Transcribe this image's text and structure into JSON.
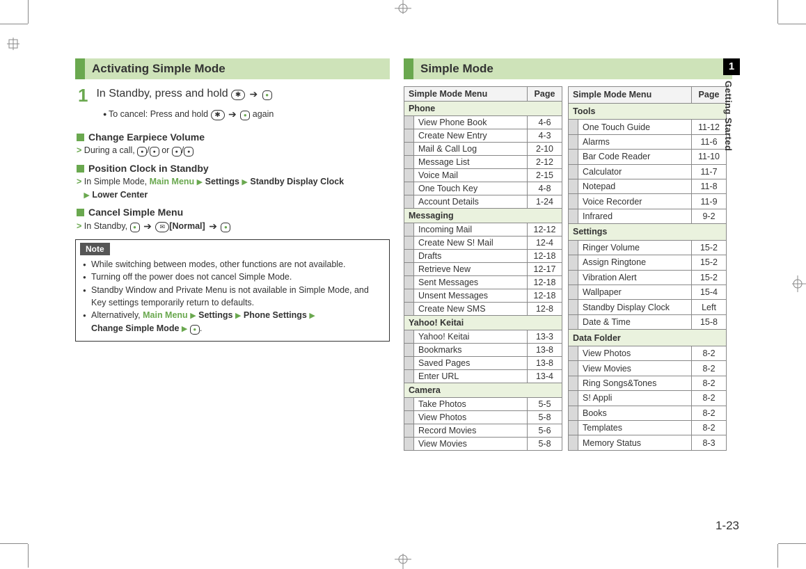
{
  "chapter_number": "1",
  "chapter_title": "Getting Started",
  "page_number": "1-23",
  "left": {
    "heading": "Activating Simple Mode",
    "step1_num": "1",
    "step1_text_a": "In Standby, press and hold ",
    "step1_cancel": "To cancel: Press and hold ",
    "step1_cancel_tail": " again",
    "sub1_head": "Change Earpiece Volume",
    "sub1_body_a": "During a call, ",
    "sub1_body_b": " or ",
    "sub2_head": "Position Clock in Standby",
    "sub2_body_a": "In Simple Mode, ",
    "sub2_mainmenu": "Main Menu",
    "sub2_settings": "Settings",
    "sub2_sdc": "Standby Display Clock",
    "sub2_lc": "Lower Center",
    "sub3_head": "Cancel Simple Menu",
    "sub3_body_a": "In Standby, ",
    "sub3_normal": "[Normal]",
    "note_label": "Note",
    "notes": [
      "While switching between modes, other functions are not available.",
      "Turning off the power does not cancel Simple Mode.",
      "Standby Window and Private Menu is not available in Simple Mode, and Key settings temporarily return to defaults."
    ],
    "note4_a": "Alternatively, ",
    "note4_mainmenu": "Main Menu",
    "note4_settings": "Settings",
    "note4_phone": "Phone Settings",
    "note4_csm": "Change Simple Mode"
  },
  "right": {
    "heading": "Simple Mode",
    "col_menu": "Simple Mode Menu",
    "col_page": "Page",
    "tableA": [
      {
        "cat": "Phone"
      },
      {
        "name": "View Phone Book",
        "page": "4-6"
      },
      {
        "name": "Create New Entry",
        "page": "4-3"
      },
      {
        "name": "Mail & Call Log",
        "page": "2-10"
      },
      {
        "name": "Message List",
        "page": "2-12"
      },
      {
        "name": "Voice Mail",
        "page": "2-15"
      },
      {
        "name": "One Touch Key",
        "page": "4-8"
      },
      {
        "name": "Account Details",
        "page": "1-24"
      },
      {
        "cat": "Messaging"
      },
      {
        "name": "Incoming Mail",
        "page": "12-12"
      },
      {
        "name": "Create New S! Mail",
        "page": "12-4"
      },
      {
        "name": "Drafts",
        "page": "12-18"
      },
      {
        "name": "Retrieve New",
        "page": "12-17"
      },
      {
        "name": "Sent Messages",
        "page": "12-18"
      },
      {
        "name": "Unsent Messages",
        "page": "12-18"
      },
      {
        "name": "Create New SMS",
        "page": "12-8"
      },
      {
        "cat": "Yahoo! Keitai"
      },
      {
        "name": "Yahoo! Keitai",
        "page": "13-3"
      },
      {
        "name": "Bookmarks",
        "page": "13-8"
      },
      {
        "name": "Saved Pages",
        "page": "13-8"
      },
      {
        "name": "Enter URL",
        "page": "13-4"
      },
      {
        "cat": "Camera"
      },
      {
        "name": "Take Photos",
        "page": "5-5"
      },
      {
        "name": "View Photos",
        "page": "5-8"
      },
      {
        "name": "Record Movies",
        "page": "5-6"
      },
      {
        "name": "View Movies",
        "page": "5-8"
      }
    ],
    "tableB": [
      {
        "cat": "Tools"
      },
      {
        "name": "One Touch Guide",
        "page": "11-12"
      },
      {
        "name": "Alarms",
        "page": "11-6"
      },
      {
        "name": "Bar Code Reader",
        "page": "11-10"
      },
      {
        "name": "Calculator",
        "page": "11-7"
      },
      {
        "name": "Notepad",
        "page": "11-8"
      },
      {
        "name": "Voice Recorder",
        "page": "11-9"
      },
      {
        "name": "Infrared",
        "page": "9-2"
      },
      {
        "cat": "Settings"
      },
      {
        "name": "Ringer Volume",
        "page": "15-2"
      },
      {
        "name": "Assign Ringtone",
        "page": "15-2"
      },
      {
        "name": "Vibration Alert",
        "page": "15-2"
      },
      {
        "name": "Wallpaper",
        "page": "15-4"
      },
      {
        "name": "Standby Display Clock",
        "page": "Left"
      },
      {
        "name": "Date & Time",
        "page": "15-8"
      },
      {
        "cat": "Data Folder"
      },
      {
        "name": "View Photos",
        "page": "8-2"
      },
      {
        "name": "View Movies",
        "page": "8-2"
      },
      {
        "name": "Ring Songs&Tones",
        "page": "8-2"
      },
      {
        "name": "S! Appli",
        "page": "8-2"
      },
      {
        "name": "Books",
        "page": "8-2"
      },
      {
        "name": "Templates",
        "page": "8-2"
      },
      {
        "name": "Memory Status",
        "page": "8-3"
      }
    ]
  }
}
